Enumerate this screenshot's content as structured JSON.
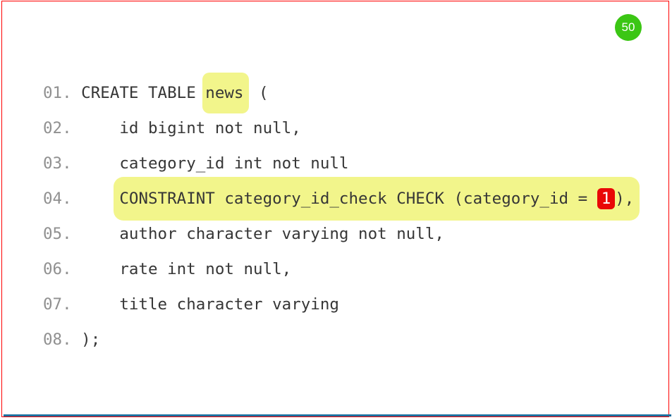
{
  "slide_number": "50",
  "lines": [
    {
      "no": "01.",
      "pre": " CREATE TABLE ",
      "hl_word": "news",
      "post": " ("
    },
    {
      "no": "02.",
      "text": "     id bigint not null,"
    },
    {
      "no": "03.",
      "text": "     category_id int not null"
    },
    {
      "no": "04.",
      "constraint_pre": "CONSTRAINT category_id_check CHECK (category_id = ",
      "constraint_val": "1",
      "constraint_post": "),"
    },
    {
      "no": "05.",
      "text": "     author character varying not null,"
    },
    {
      "no": "06.",
      "text": "     rate int not null,"
    },
    {
      "no": "07.",
      "text": "     title character varying"
    },
    {
      "no": "08.",
      "text": " );"
    }
  ]
}
